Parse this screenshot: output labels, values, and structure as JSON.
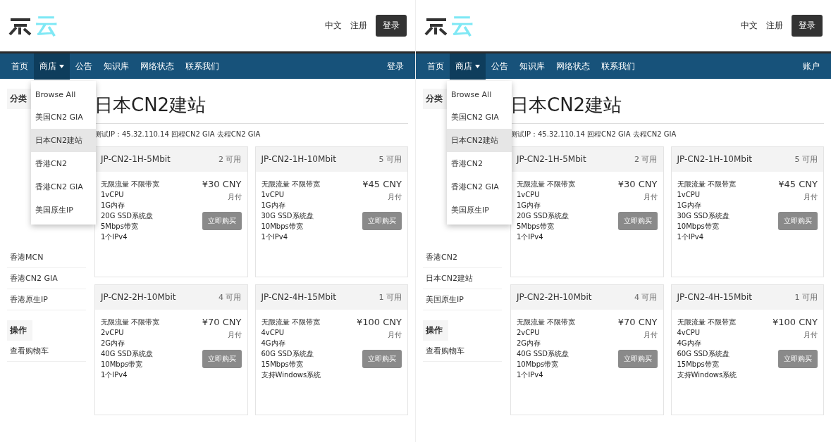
{
  "panels": [
    {
      "logo": "云",
      "top_links": [
        "中文",
        "注册"
      ],
      "login_button": "登录",
      "nav": [
        {
          "label": "首页",
          "selected": false,
          "dropdown": false
        },
        {
          "label": "商店",
          "selected": true,
          "dropdown": true
        },
        {
          "label": "公告",
          "selected": false,
          "dropdown": false
        },
        {
          "label": "知识库",
          "selected": false,
          "dropdown": false
        },
        {
          "label": "网络状态",
          "selected": false,
          "dropdown": false
        },
        {
          "label": "联系我们",
          "selected": false,
          "dropdown": false
        }
      ],
      "nav_right": "登录",
      "dropdown_items": [
        {
          "label": "Browse All",
          "selected": false
        },
        {
          "label": "美国CN2 GIA",
          "selected": false
        },
        {
          "label": "日本CN2建站",
          "selected": true
        },
        {
          "label": "香港CN2",
          "selected": false
        },
        {
          "label": "香港CN2 GIA",
          "selected": false
        },
        {
          "label": "美国原生IP",
          "selected": false
        }
      ],
      "sidebar": {
        "heading": "分类",
        "items": [
          {
            "label": "香港MCN",
            "selected": false
          },
          {
            "label": "香港CN2 GIA",
            "selected": false
          },
          {
            "label": "香港原生IP",
            "selected": false
          }
        ]
      },
      "cart": {
        "heading": "操作",
        "link": "查看购物车"
      },
      "page_title": "日本CN2建站",
      "intro": "测试IP：45.32.110.14 回程CN2 GIA 去程CN2 GIA",
      "products": [
        {
          "name": "JP-CN2-1H-5Mbit",
          "stock": "2 可用",
          "features": [
            "无限流量 不限带宽",
            "1vCPU",
            "1G内存",
            "20G SSD系统盘",
            "5Mbps带宽",
            "1个IPv4"
          ],
          "price": "¥30 CNY",
          "cycle": "月付",
          "button": "立即购买"
        },
        {
          "name": "JP-CN2-1H-10Mbit",
          "stock": "5 可用",
          "features": [
            "无限流量 不限带宽",
            "1vCPU",
            "1G内存",
            "30G SSD系统盘",
            "10Mbps带宽",
            "1个IPv4"
          ],
          "price": "¥45 CNY",
          "cycle": "月付",
          "button": "立即购买"
        },
        {
          "name": "JP-CN2-2H-10Mbit",
          "stock": "4 可用",
          "features": [
            "无限流量 不限带宽",
            "2vCPU",
            "2G内存",
            "40G SSD系统盘",
            "10Mbps带宽",
            "1个IPv4"
          ],
          "price": "¥70 CNY",
          "cycle": "月付",
          "button": "立即购买"
        },
        {
          "name": "JP-CN2-4H-15Mbit",
          "stock": "1 可用",
          "features": [
            "无限流量 不限带宽",
            "4vCPU",
            "4G内存",
            "60G SSD系统盘",
            "15Mbps带宽",
            "支持Windows系统"
          ],
          "price": "¥100 CNY",
          "cycle": "月付",
          "button": "立即购买"
        }
      ]
    },
    {
      "logo": "云",
      "top_links": [
        "中文",
        "注册"
      ],
      "login_button": "登录",
      "nav": [
        {
          "label": "首页",
          "selected": false,
          "dropdown": false
        },
        {
          "label": "商店",
          "selected": true,
          "dropdown": true
        },
        {
          "label": "公告",
          "selected": false,
          "dropdown": false
        },
        {
          "label": "知识库",
          "selected": false,
          "dropdown": false
        },
        {
          "label": "网络状态",
          "selected": false,
          "dropdown": false
        },
        {
          "label": "联系我们",
          "selected": false,
          "dropdown": false
        }
      ],
      "nav_right": "账户",
      "dropdown_items": [
        {
          "label": "Browse All",
          "selected": false
        },
        {
          "label": "美国CN2 GIA",
          "selected": false
        },
        {
          "label": "日本CN2建站",
          "selected": true
        },
        {
          "label": "香港CN2",
          "selected": false
        },
        {
          "label": "香港CN2 GIA",
          "selected": false
        },
        {
          "label": "美国原生IP",
          "selected": false
        }
      ],
      "sidebar": {
        "heading": "分类",
        "items": [
          {
            "label": "香港CN2",
            "selected": false
          },
          {
            "label": "日本CN2建站",
            "selected": false
          },
          {
            "label": "美国原生IP",
            "selected": false
          }
        ]
      },
      "cart": {
        "heading": "操作",
        "link": "查看购物车"
      },
      "page_title": "日本CN2建站",
      "intro": "测试IP：45.32.110.14 回程CN2 GIA 去程CN2 GIA",
      "products": [
        {
          "name": "JP-CN2-1H-5Mbit",
          "stock": "2 可用",
          "features": [
            "无限流量 不限带宽",
            "1vCPU",
            "1G内存",
            "20G SSD系统盘",
            "5Mbps带宽",
            "1个IPv4"
          ],
          "price": "¥30 CNY",
          "cycle": "月付",
          "button": "立即购买"
        },
        {
          "name": "JP-CN2-1H-10Mbit",
          "stock": "5 可用",
          "features": [
            "无限流量 不限带宽",
            "1vCPU",
            "1G内存",
            "30G SSD系统盘",
            "10Mbps带宽",
            "1个IPv4"
          ],
          "price": "¥45 CNY",
          "cycle": "月付",
          "button": "立即购买"
        },
        {
          "name": "JP-CN2-2H-10Mbit",
          "stock": "4 可用",
          "features": [
            "无限流量 不限带宽",
            "2vCPU",
            "2G内存",
            "40G SSD系统盘",
            "10Mbps带宽",
            "1个IPv4"
          ],
          "price": "¥70 CNY",
          "cycle": "月付",
          "button": "立即购买"
        },
        {
          "name": "JP-CN2-4H-15Mbit",
          "stock": "1 可用",
          "features": [
            "无限流量 不限带宽",
            "4vCPU",
            "4G内存",
            "60G SSD系统盘",
            "15Mbps带宽",
            "支持Windows系统"
          ],
          "price": "¥100 CNY",
          "cycle": "月付",
          "button": "立即购买"
        }
      ]
    }
  ]
}
